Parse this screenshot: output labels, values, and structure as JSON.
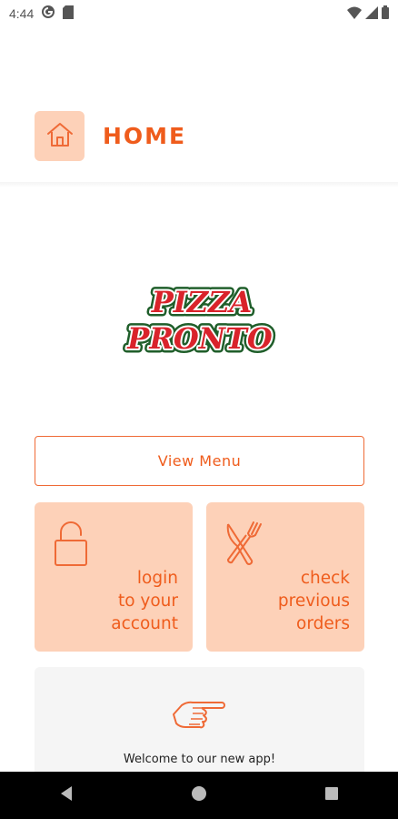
{
  "status_bar": {
    "time": "4:44",
    "icons": [
      "shield-g-icon",
      "sd-card-icon",
      "wifi-icon",
      "signal-icon",
      "battery-icon"
    ]
  },
  "header": {
    "title": "HOME",
    "icon": "home-icon"
  },
  "logo": {
    "line1": "PIZZA",
    "line2": "PRONTO"
  },
  "actions": {
    "view_menu": "View Menu",
    "login_tile": {
      "label": "login\nto your\naccount",
      "icon": "lock-icon"
    },
    "orders_tile": {
      "label": "check\nprevious\norders",
      "icon": "cutlery-icon"
    }
  },
  "welcome": {
    "text": "Welcome to our new app!",
    "icon": "pointing-hand-icon"
  },
  "nav": {
    "back_icon": "back-triangle-icon",
    "home_icon": "home-circle-icon",
    "recents_icon": "recents-square-icon"
  },
  "colors": {
    "accent": "#ef5c1c",
    "tile_bg": "#fdd1b8",
    "card_bg": "#f5f5f5",
    "logo_red": "#d9232b",
    "logo_green": "#1f5e2a"
  }
}
